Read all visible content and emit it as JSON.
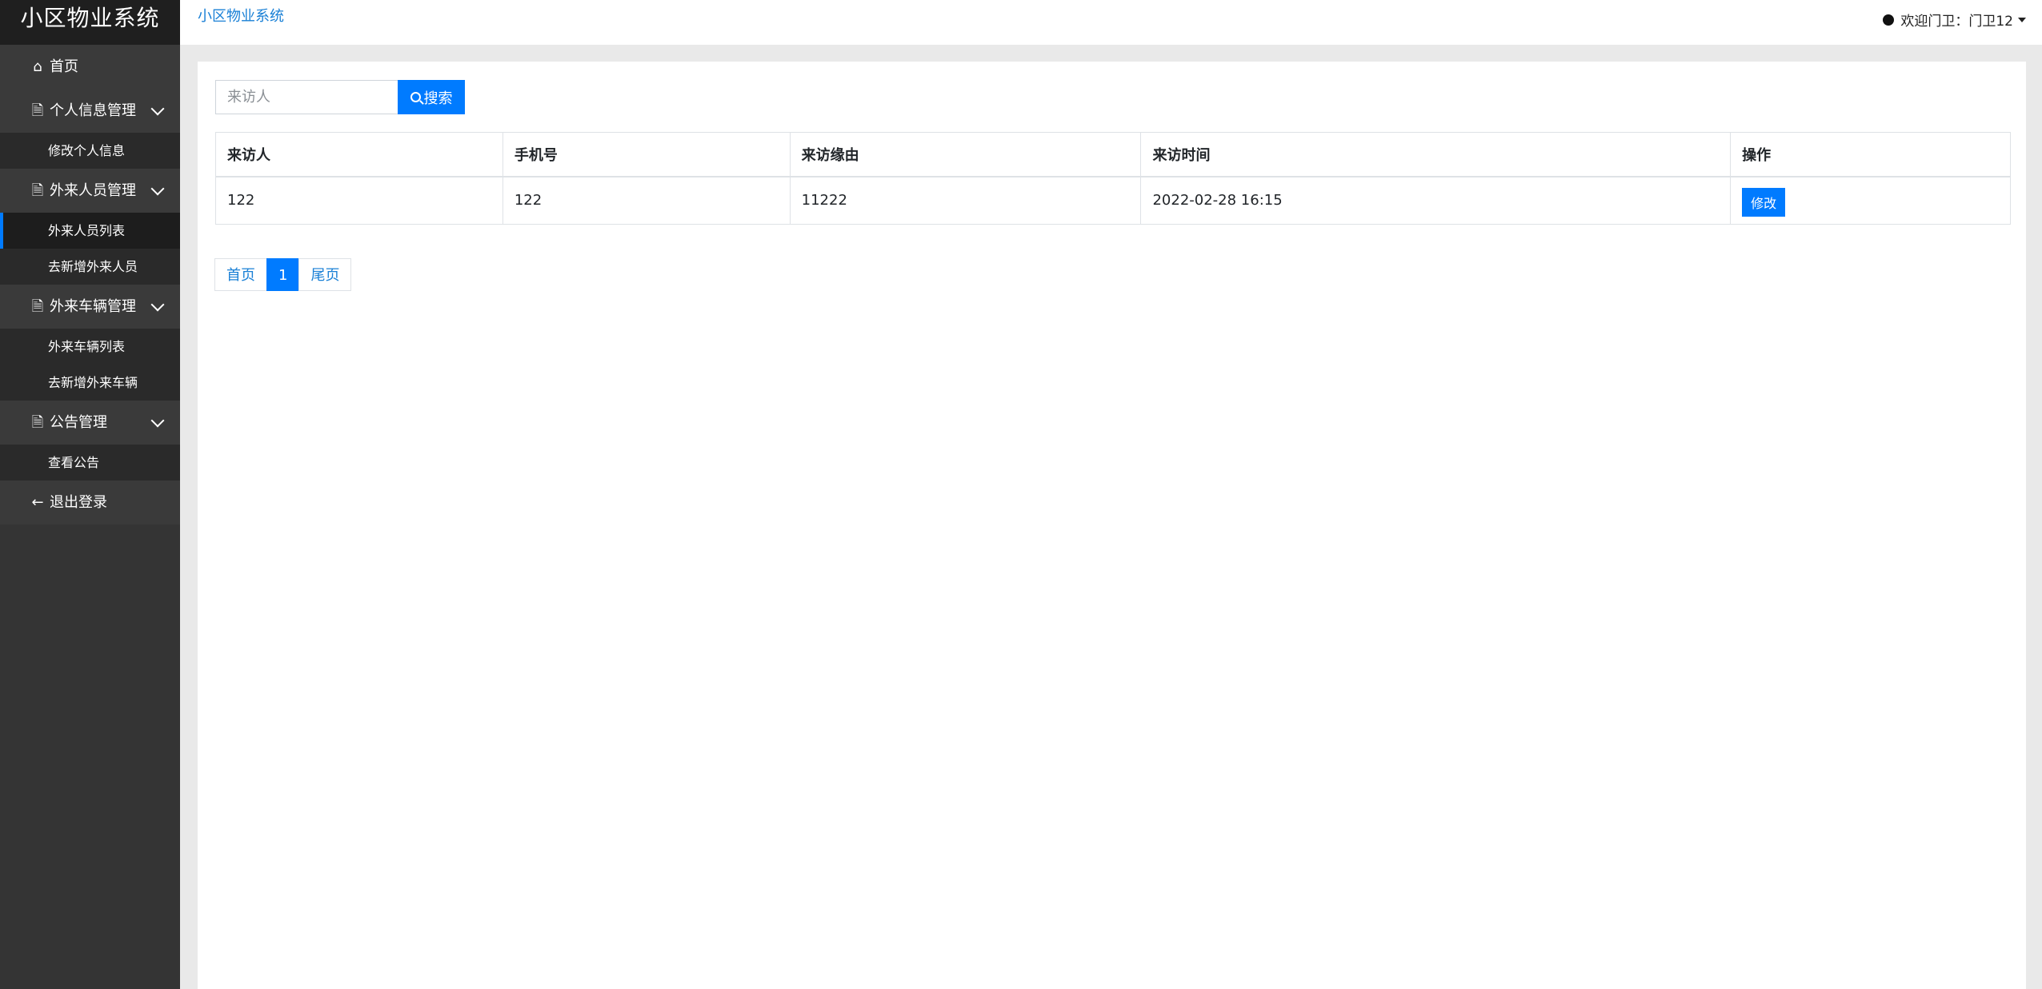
{
  "app": {
    "title": "小区物业系统"
  },
  "topbar": {
    "breadcrumb": "小区物业系统",
    "user": "欢迎门卫：门卫12"
  },
  "sidebar": {
    "home": "首页",
    "groups": [
      {
        "label": "个人信息管理",
        "items": [
          "修改个人信息"
        ]
      },
      {
        "label": "外来人员管理",
        "items": [
          "外来人员列表",
          "去新增外来人员"
        ]
      },
      {
        "label": "外来车辆管理",
        "items": [
          "外来车辆列表",
          "去新增外来车辆"
        ]
      },
      {
        "label": "公告管理",
        "items": [
          "查看公告"
        ]
      }
    ],
    "logout": "退出登录"
  },
  "search": {
    "placeholder": "来访人",
    "button": "搜索"
  },
  "table": {
    "headers": [
      "来访人",
      "手机号",
      "来访缘由",
      "来访时间",
      "操作"
    ],
    "rows": [
      {
        "visitor": "122",
        "phone": "122",
        "reason": "11222",
        "time": "2022-02-28 16:15",
        "action": "修改"
      }
    ]
  },
  "pagination": {
    "first": "首页",
    "current": "1",
    "last": "尾页"
  }
}
